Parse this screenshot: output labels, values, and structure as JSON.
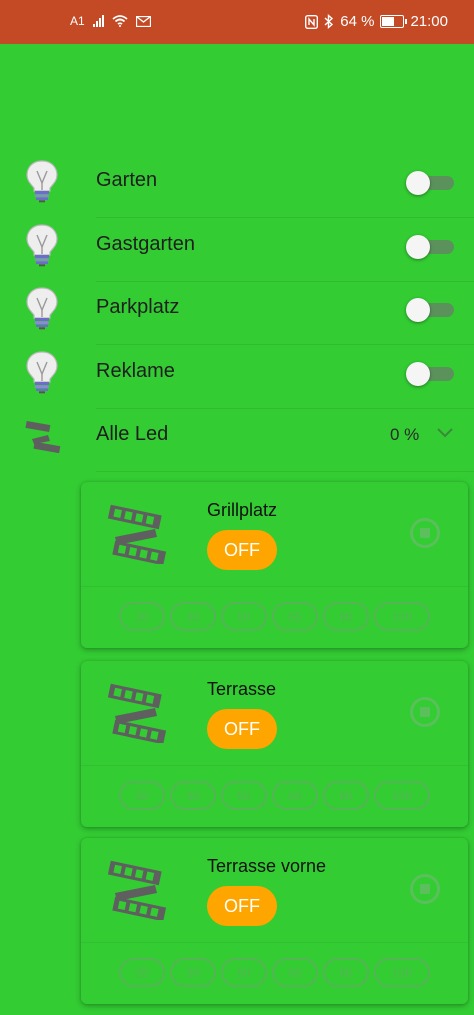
{
  "status_bar": {
    "carrier": "A1",
    "battery": "64 %",
    "battery_level": 0.64,
    "time": "21:00",
    "icons": [
      "signal-icon",
      "wifi-icon",
      "mail-icon",
      "nfc-icon",
      "bluetooth-icon",
      "battery-icon"
    ]
  },
  "lights": [
    {
      "label": "Garten",
      "on": false,
      "icon": "lightbulb-icon"
    },
    {
      "label": "Gastgarten",
      "on": false,
      "icon": "lightbulb-icon"
    },
    {
      "label": "Parkplatz",
      "on": false,
      "icon": "lightbulb-icon"
    },
    {
      "label": "Reklame",
      "on": false,
      "icon": "lightbulb-icon"
    }
  ],
  "all_led": {
    "label": "Alle Led",
    "value": "0 %",
    "icon": "led-strip-icon",
    "expanded": true
  },
  "led_groups": [
    {
      "title": "Grillplatz",
      "button": "OFF",
      "levels": [
        "20",
        "30",
        "50",
        "65",
        "80",
        "100"
      ]
    },
    {
      "title": "Terrasse",
      "button": "OFF",
      "levels": [
        "20",
        "30",
        "50",
        "65",
        "80",
        "100"
      ]
    },
    {
      "title": "Terrasse vorne",
      "button": "OFF",
      "levels": [
        "20",
        "30",
        "50",
        "65",
        "80",
        "100"
      ]
    }
  ],
  "colors": {
    "background": "#33cc33",
    "status_bar": "#c44a26",
    "off_button": "#ffa500"
  }
}
